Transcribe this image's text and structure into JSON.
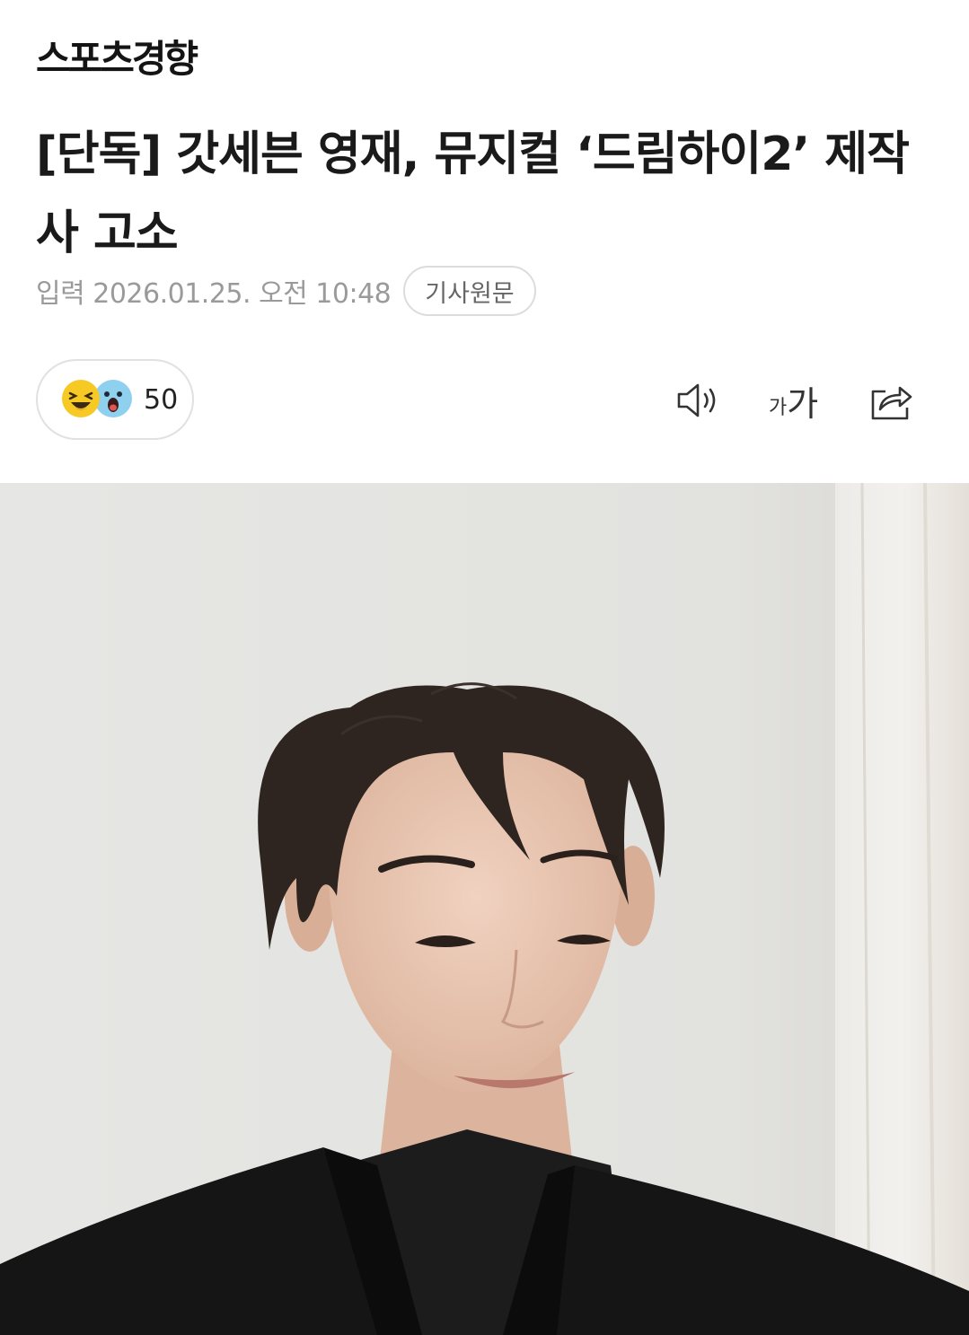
{
  "header": {
    "brand": "스포츠경향"
  },
  "article": {
    "title_line1": "[단독] 갓세븐 영재, 뮤지컬 ‘드림하이2’ 제작",
    "title_line2": "사 고소",
    "published": "입력 2026.01.25. 오전 10:48",
    "original_button": "기사원문"
  },
  "reactions": {
    "count": "50",
    "emojis": [
      "laughing-emoji-icon",
      "surprised-emoji-icon"
    ]
  },
  "toolbar": {
    "font_small": "가",
    "font_big": "가",
    "icons": [
      "speaker-icon",
      "font-size-icon",
      "share-icon"
    ]
  },
  "colors": {
    "meta_text": "#9a9a9a",
    "emoji_yellow": "#f6c925",
    "emoji_blue": "#8fd0ef",
    "photo_wall": "#e4e4e2",
    "hair": "#2e2520",
    "jacket": "#151515"
  }
}
